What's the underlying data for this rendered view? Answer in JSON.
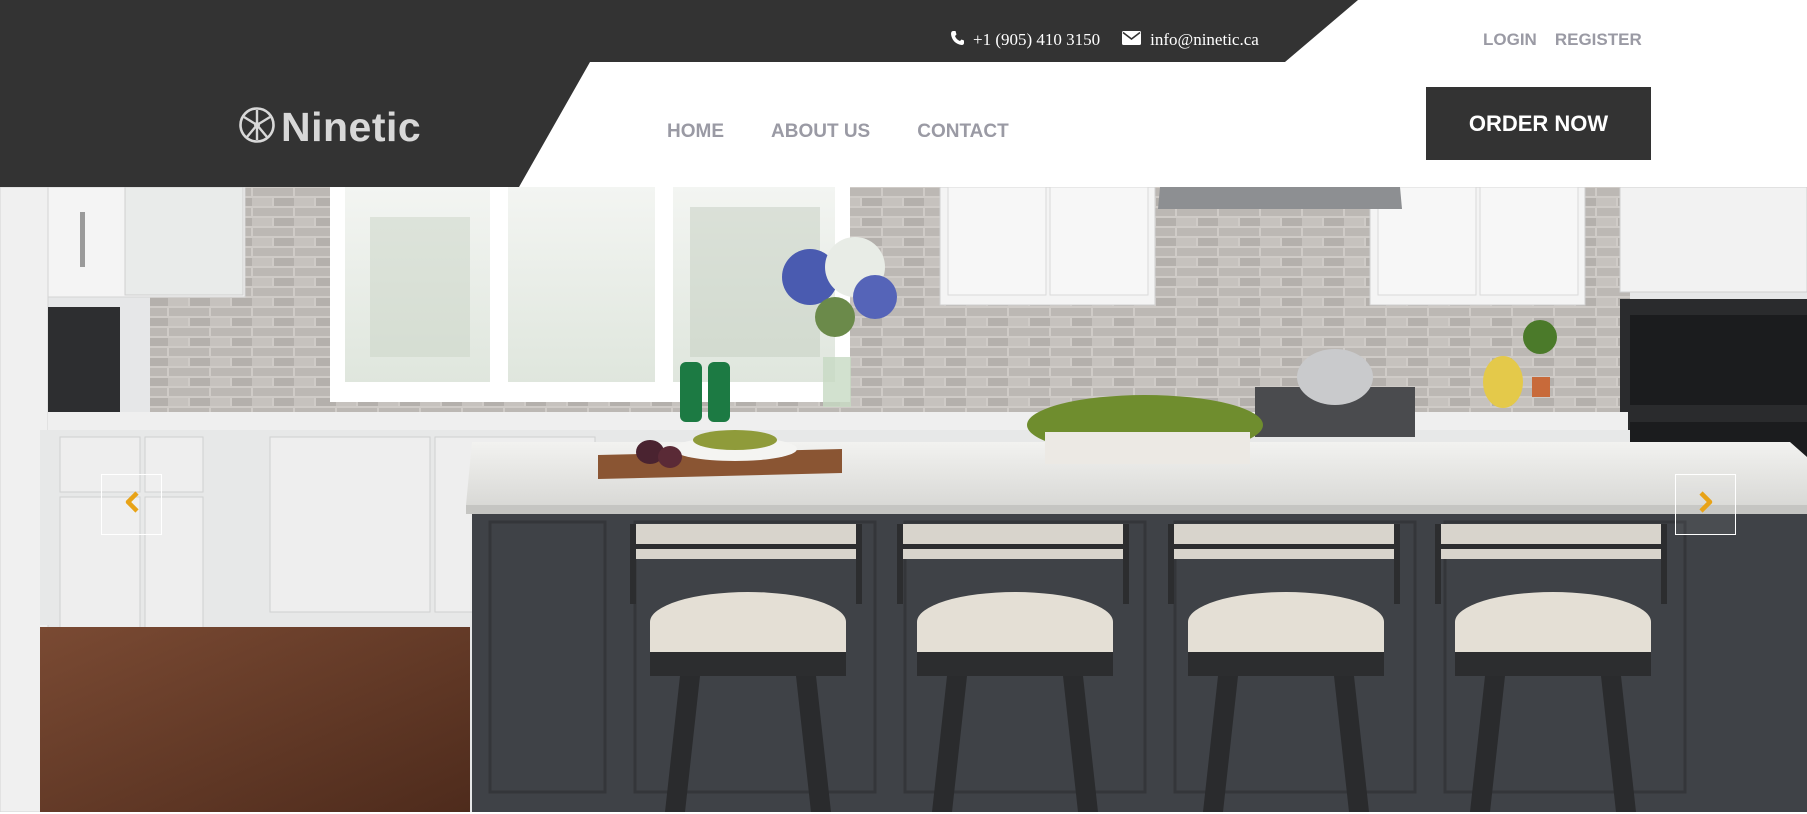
{
  "contact": {
    "phone": "+1 (905) 410 3150",
    "email": "info@ninetic.ca",
    "phone_icon": "phone-icon",
    "email_icon": "envelope-icon"
  },
  "auth": {
    "login": "LOGIN",
    "register": "REGISTER"
  },
  "brand": {
    "name": "Ninetic",
    "icon": "ninetic-logo-icon"
  },
  "nav": {
    "items": [
      {
        "label": "HOME"
      },
      {
        "label": "ABOUT US"
      },
      {
        "label": "CONTACT"
      }
    ]
  },
  "cta": {
    "label": "ORDER NOW"
  },
  "slider": {
    "prev_icon": "chevron-left-icon",
    "next_icon": "chevron-right-icon",
    "arrow_color": "#e8a317"
  },
  "colors": {
    "header_dark": "#333333",
    "nav_text": "#9a9aa4",
    "accent": "#e8a317"
  }
}
